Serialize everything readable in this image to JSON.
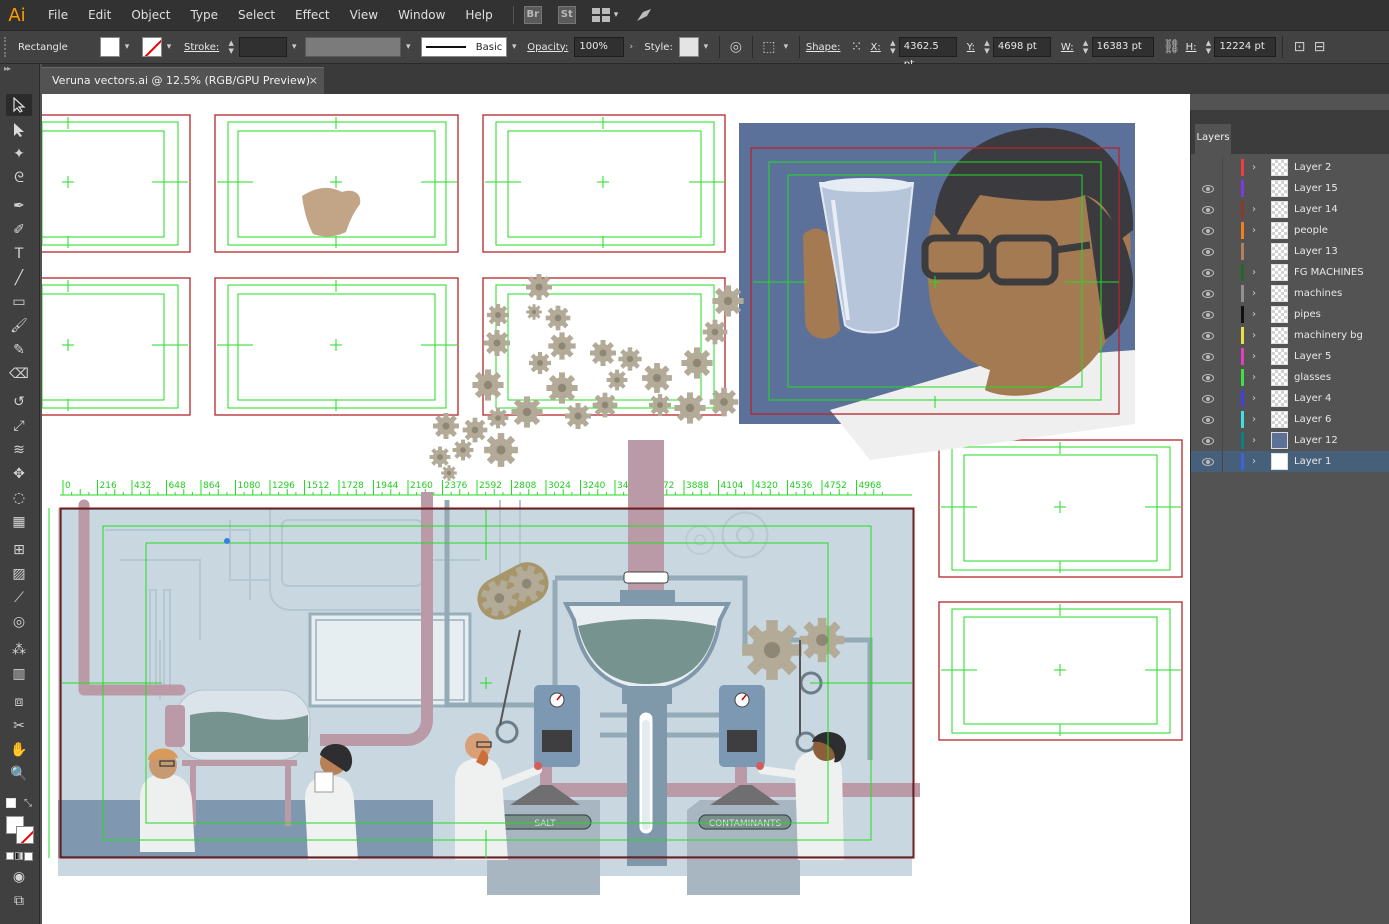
{
  "app": {
    "logo": "Ai"
  },
  "menu": [
    "File",
    "Edit",
    "Object",
    "Type",
    "Select",
    "Effect",
    "View",
    "Window",
    "Help"
  ],
  "bridge_buttons": [
    "Br",
    "St"
  ],
  "control": {
    "tool_name": "Rectangle",
    "stroke_label": "Stroke:",
    "brush_label": "Basic",
    "opacity_label": "Opacity:",
    "opacity_value": "100%",
    "style_label": "Style:",
    "shape_label": "Shape:",
    "x_label": "X:",
    "x_value": "4362.5 pt",
    "y_label": "Y:",
    "y_value": "4698 pt",
    "w_label": "W:",
    "w_value": "16383 pt",
    "h_label": "H:",
    "h_value": "12224 pt"
  },
  "document": {
    "tab_title": "Veruna vectors.ai @ 12.5% (RGB/GPU Preview)",
    "close": "×"
  },
  "ruler": {
    "ticks": [
      "0",
      "216",
      "432",
      "648",
      "864",
      "1080",
      "1296",
      "1512",
      "1728",
      "1944",
      "2160",
      "2376",
      "2592",
      "2808",
      "3024",
      "3240",
      "3456",
      "3672",
      "3888",
      "4104",
      "4320",
      "4536",
      "4752",
      "4968"
    ]
  },
  "illustration": {
    "salt_label": "SALT",
    "contaminants_label": "CONTAMINANTS"
  },
  "layers_panel": {
    "title": "Layers",
    "layers": [
      {
        "name": "Layer 2",
        "color": "#e84040",
        "visible": false,
        "expandable": true,
        "thumb": "checker"
      },
      {
        "name": "Layer 15",
        "color": "#7a3ce0",
        "visible": true,
        "expandable": false,
        "thumb": "checker"
      },
      {
        "name": "Layer 14",
        "color": "#8a3a2a",
        "visible": true,
        "expandable": true,
        "thumb": "checker"
      },
      {
        "name": "people",
        "color": "#f07f20",
        "visible": true,
        "expandable": true,
        "thumb": "checker"
      },
      {
        "name": "Layer 13",
        "color": "#b08060",
        "visible": true,
        "expandable": false,
        "thumb": "checker"
      },
      {
        "name": "FG MACHINES",
        "color": "#1f6a2a",
        "visible": true,
        "expandable": true,
        "thumb": "checker"
      },
      {
        "name": "machines",
        "color": "#909090",
        "visible": true,
        "expandable": true,
        "thumb": "checker"
      },
      {
        "name": "pipes",
        "color": "#111111",
        "visible": true,
        "expandable": true,
        "thumb": "checker"
      },
      {
        "name": "machinery bg",
        "color": "#e8e040",
        "visible": true,
        "expandable": true,
        "thumb": "light"
      },
      {
        "name": "Layer 5",
        "color": "#e040c0",
        "visible": true,
        "expandable": true,
        "thumb": "tan"
      },
      {
        "name": "glasses",
        "color": "#40e040",
        "visible": true,
        "expandable": true,
        "thumb": "checker"
      },
      {
        "name": "Layer 4",
        "color": "#4040e0",
        "visible": true,
        "expandable": true,
        "thumb": "tan"
      },
      {
        "name": "Layer 6",
        "color": "#40e0e0",
        "visible": true,
        "expandable": true,
        "thumb": "tan"
      },
      {
        "name": "Layer 12",
        "color": "#108080",
        "visible": true,
        "expandable": true,
        "thumb": "blue"
      },
      {
        "name": "Layer 1",
        "color": "#4060e0",
        "visible": true,
        "expandable": true,
        "thumb": "solid",
        "selected": true
      }
    ]
  }
}
